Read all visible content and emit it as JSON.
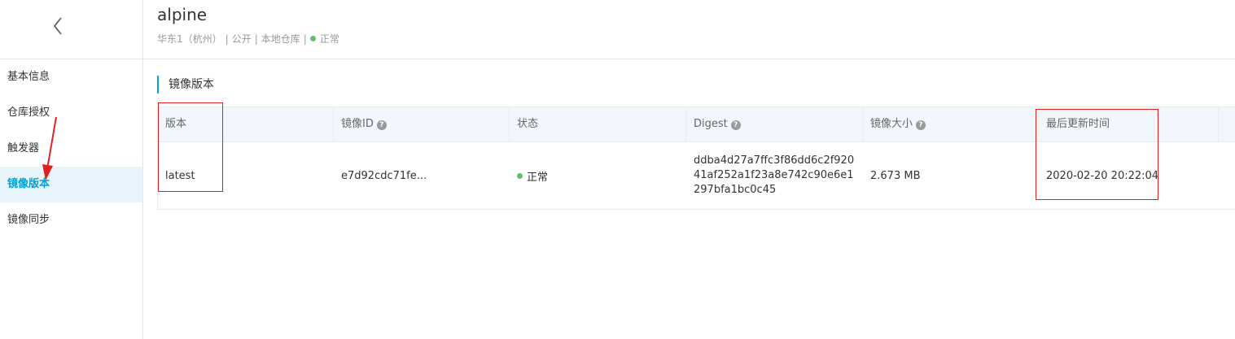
{
  "sidebar": {
    "back_icon": "chevron-left-icon",
    "items": [
      {
        "label": "基本信息",
        "active": false
      },
      {
        "label": "仓库授权",
        "active": false
      },
      {
        "label": "触发器",
        "active": false
      },
      {
        "label": "镜像版本",
        "active": true
      },
      {
        "label": "镜像同步",
        "active": false
      }
    ]
  },
  "header": {
    "title": "alpine",
    "region": "华东1（杭州）",
    "visibility": "公开",
    "repo_type": "本地仓库",
    "status": "正常",
    "status_color": "#5cc36d"
  },
  "section": {
    "title": "镜像版本"
  },
  "table": {
    "columns": [
      {
        "label": "版本",
        "help": false
      },
      {
        "label": "镜像ID",
        "help": true
      },
      {
        "label": "状态",
        "help": false
      },
      {
        "label": "Digest",
        "help": true
      },
      {
        "label": "镜像大小",
        "help": true
      },
      {
        "label": "最后更新时间",
        "help": false
      }
    ],
    "rows": [
      {
        "version": "latest",
        "image_id": "e7d92cdc71fe...",
        "status": "正常",
        "digest": "ddba4d27a7ffc3f86dd6c2f92041af252a1f23a8e742c90e6e1297bfa1bc0c45",
        "size": "2.673 MB",
        "updated": "2020-02-20 20:22:04"
      }
    ]
  },
  "colors": {
    "accent": "#00a1d6",
    "annotation_red": "#e02020",
    "status_green": "#5cc36d"
  }
}
